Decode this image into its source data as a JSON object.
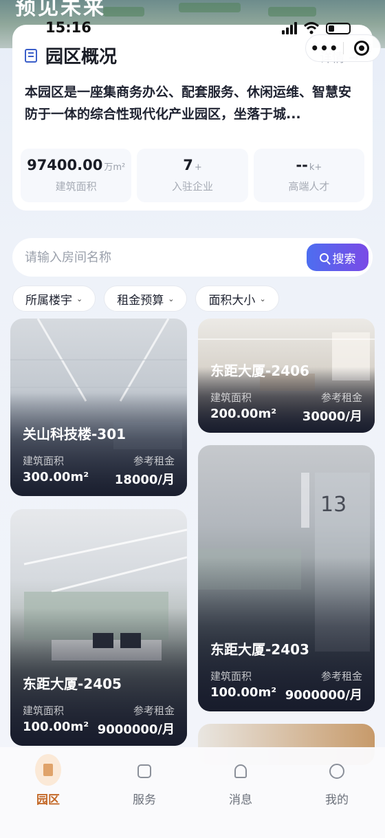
{
  "hero": {
    "title": "预见未来"
  },
  "status_bar": {
    "time": "15:16"
  },
  "overview": {
    "title": "园区概况",
    "detail_link": "详情 →",
    "description": "本园区是一座集商务办公、配套服务、休闲运维、智慧安防于一体的综合性现代化产业园区，坐落于城...",
    "stats": [
      {
        "value": "97400.00",
        "unit": "万m²",
        "label": "建筑面积"
      },
      {
        "value": "7",
        "unit": "+",
        "label": "入驻企业"
      },
      {
        "value": "--",
        "unit": "k+",
        "label": "高端人才"
      }
    ]
  },
  "mini_program": {
    "more": "•••"
  },
  "search": {
    "placeholder": "请输入房间名称",
    "button_label": "搜索"
  },
  "filters": [
    "所属楼宇",
    "租金预算",
    "面积大小"
  ],
  "rooms": [
    {
      "name": "关山科技楼-301",
      "area_label": "建筑面积",
      "area": "300.00m²",
      "rent_label": "参考租金",
      "rent": "18000/月"
    },
    {
      "name": "东距大厦-2406",
      "area_label": "建筑面积",
      "area": "200.00m²",
      "rent_label": "参考租金",
      "rent": "30000/月"
    },
    {
      "name": "东距大厦-2405",
      "area_label": "建筑面积",
      "area": "100.00m²",
      "rent_label": "参考租金",
      "rent": "9000000/月"
    },
    {
      "name": "东距大厦-2403",
      "area_label": "建筑面积",
      "area": "100.00m²",
      "rent_label": "参考租金",
      "rent": "9000000/月"
    }
  ],
  "tabbar": [
    {
      "label": "园区",
      "icon": "park-icon",
      "active": true
    },
    {
      "label": "服务",
      "icon": "service-icon",
      "active": false
    },
    {
      "label": "消息",
      "icon": "bell-icon",
      "active": false
    },
    {
      "label": "我的",
      "icon": "profile-icon",
      "active": false
    }
  ],
  "colors": {
    "accent_gradient_start": "#4d6ef0",
    "accent_gradient_end": "#7a4ae6",
    "active_tab": "#c46a2a"
  }
}
